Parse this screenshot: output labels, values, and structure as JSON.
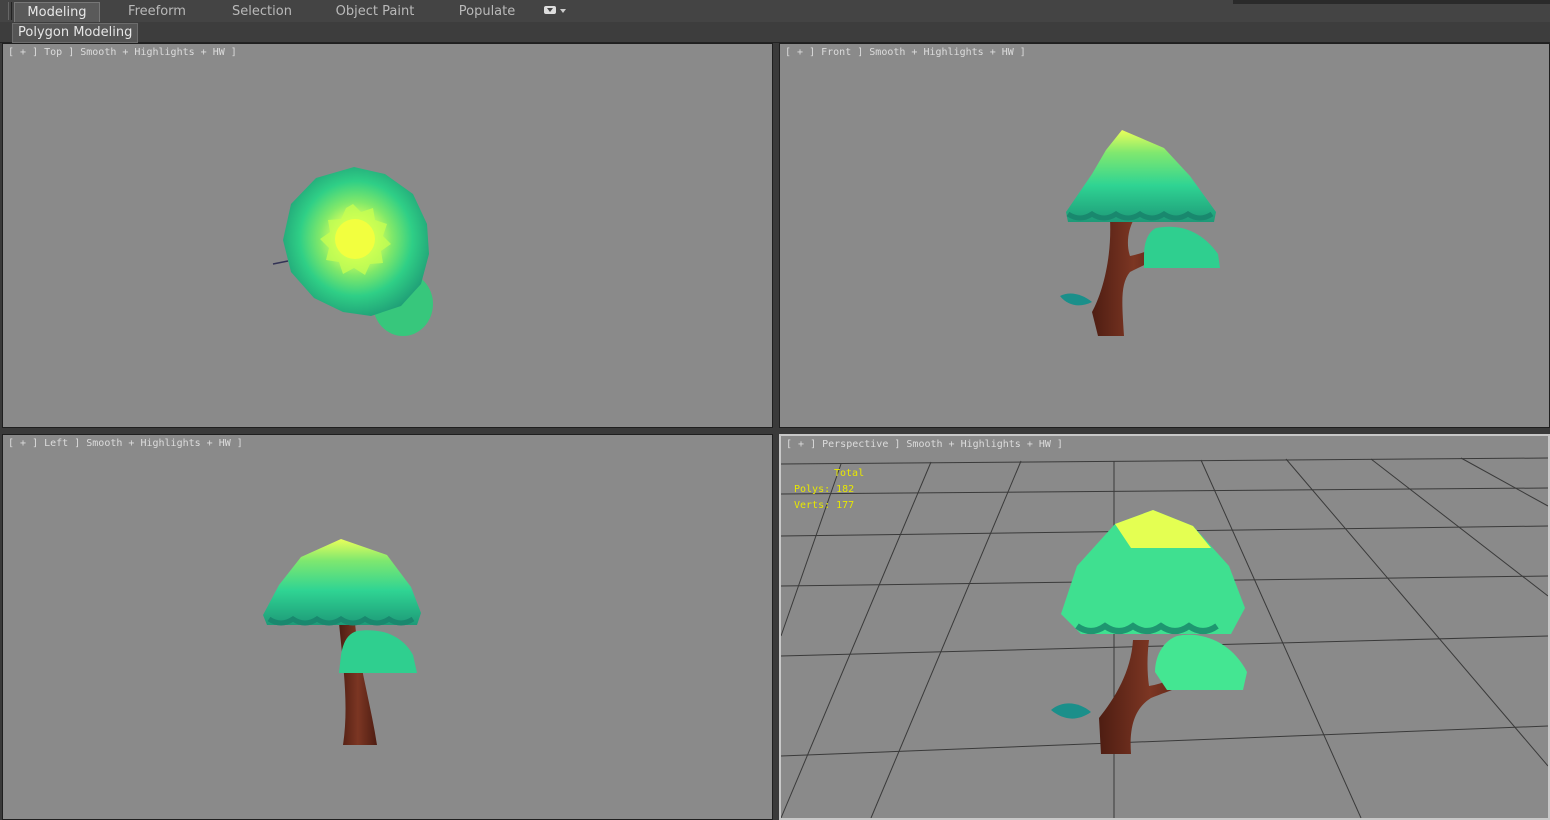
{
  "ribbon": {
    "tabs": [
      {
        "label": "Modeling",
        "active": true
      },
      {
        "label": "Freeform",
        "active": false
      },
      {
        "label": "Selection",
        "active": false
      },
      {
        "label": "Object Paint",
        "active": false
      },
      {
        "label": "Populate",
        "active": false
      }
    ],
    "dropdown_icon": "ribbon-options-icon"
  },
  "panel": {
    "label": "Polygon Modeling"
  },
  "viewports": {
    "top": {
      "label": "[ + ] Top ] Smooth + Highlights + HW ]"
    },
    "front": {
      "label": "[ + ] Front ] Smooth + Highlights + HW ]"
    },
    "left": {
      "label": "[ + ] Left ] Smooth + Highlights + HW ]"
    },
    "perspective": {
      "label": "[ + ] Perspective ] Smooth + Highlights + HW ]",
      "active": true
    }
  },
  "stats": {
    "title": "Total",
    "polys": "Polys: 182",
    "verts": "Verts: 177"
  },
  "colors": {
    "viewport_bg": "#8a8a8a",
    "foliage": "#2fcf8f",
    "foliage_highlight": "#eaff5a",
    "trunk": "#6b2c1d",
    "stats_text": "#e8e800",
    "active_border": "#c8c8c8"
  }
}
